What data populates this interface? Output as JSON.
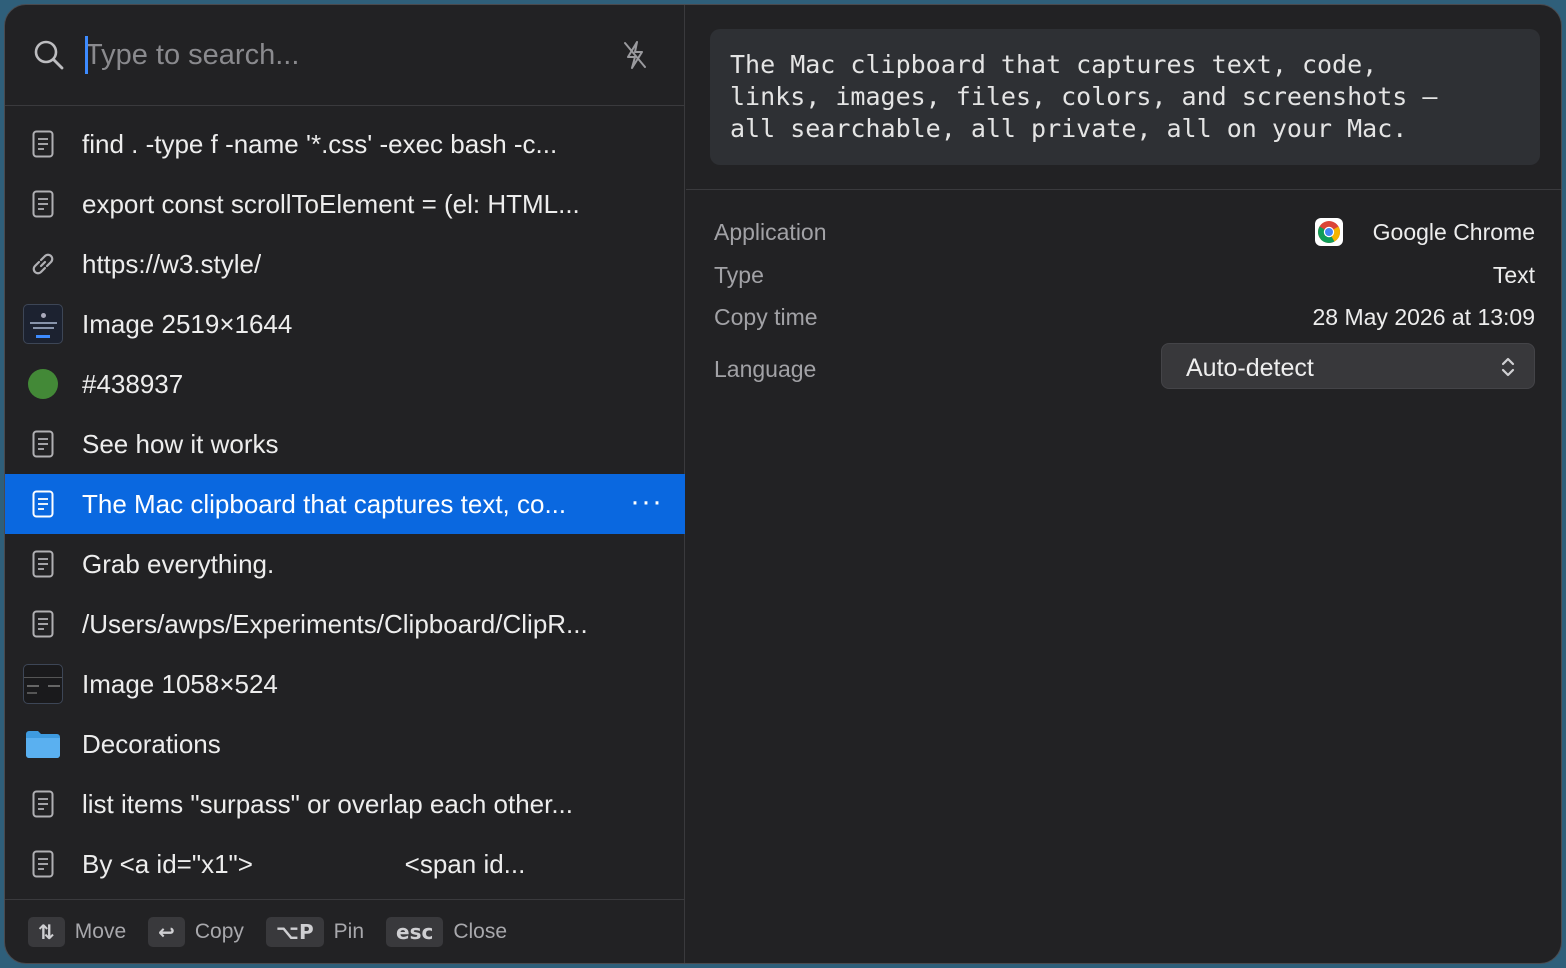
{
  "search": {
    "placeholder": "Type to search..."
  },
  "items": [
    {
      "label": "find . -type f -name '*.css' -exec bash -c...",
      "icon": "document-icon"
    },
    {
      "label": "export const scrollToElement = (el: HTML...",
      "icon": "document-icon"
    },
    {
      "label": "https://w3.style/",
      "icon": "link-icon"
    },
    {
      "label": "Image 2519×1644",
      "icon": "image-thumbnail"
    },
    {
      "label": "#438937",
      "icon": "color-swatch",
      "color": "#438937"
    },
    {
      "label": "See how it works",
      "icon": "document-icon"
    },
    {
      "label": "The Mac clipboard that captures text, co...",
      "icon": "document-icon",
      "selected": true,
      "more": "···"
    },
    {
      "label": "Grab everything.",
      "icon": "document-icon"
    },
    {
      "label": "/Users/awps/Experiments/Clipboard/ClipR...",
      "icon": "document-icon"
    },
    {
      "label": "Image 1058×524",
      "icon": "image-thumbnail"
    },
    {
      "label": "Decorations",
      "icon": "folder-icon"
    },
    {
      "label": "list items \"surpass\" or overlap each other...",
      "icon": "document-icon"
    },
    {
      "label": "By <a id=\"x1\">                     <span id...",
      "icon": "document-icon"
    }
  ],
  "footer": [
    {
      "key": "⇅",
      "label": "Move"
    },
    {
      "key": "↩",
      "label": "Copy"
    },
    {
      "key": "⌥P",
      "label": "Pin"
    },
    {
      "key": "esc",
      "label": "Close"
    }
  ],
  "preview": {
    "text": "The Mac clipboard that captures text, code,\nlinks, images, files, colors, and screenshots —\nall searchable, all private, all on your Mac."
  },
  "details": {
    "application_label": "Application",
    "application_value": "Google Chrome",
    "type_label": "Type",
    "type_value": "Text",
    "copy_time_label": "Copy time",
    "copy_time_value": "28 May 2026 at 13:09",
    "language_label": "Language",
    "language_value": "Auto-detect"
  },
  "colors": {
    "selection": "#0a68e0",
    "background": "#222224",
    "caret": "#3d8bff",
    "folder": "#5ab0f0"
  }
}
